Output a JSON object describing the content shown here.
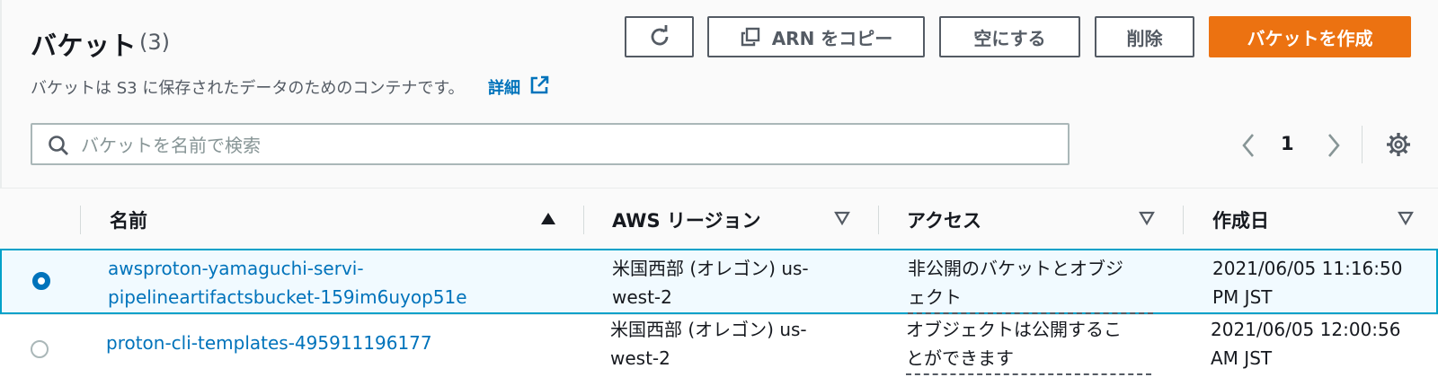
{
  "header": {
    "title": "バケット",
    "count": "(3)",
    "description": "バケットは S3 に保存されたデータのためのコンテナです。",
    "learn_more": "詳細"
  },
  "toolbar": {
    "copy_arn": "ARN をコピー",
    "empty": "空にする",
    "delete": "削除",
    "create": "バケットを作成"
  },
  "search": {
    "placeholder": "バケットを名前で検索",
    "value": ""
  },
  "pagination": {
    "current_page": "1"
  },
  "table": {
    "columns": [
      "名前",
      "AWS リージョン",
      "アクセス",
      "作成日"
    ],
    "sorted_column": "名前",
    "sort_direction": "ascending",
    "rows": [
      {
        "selected": true,
        "name_line1": "awsproton-yamaguchi-servi-",
        "name_line2": "pipelineartifactsbucket-159im6uyop51e",
        "region_line1": "米国西部 (オレゴン) us-",
        "region_line2": "west-2",
        "access_line1": "非公開のバケットとオブジ",
        "access_line2": "ェクト",
        "created_line1": "2021/06/05 11:16:50",
        "created_line2": "PM JST"
      },
      {
        "selected": false,
        "name_line1": "proton-cli-templates-495911196177",
        "name_line2": "",
        "region_line1": "米国西部 (オレゴン) us-",
        "region_line2": "west-2",
        "access_line1": "オブジェクトは公開するこ",
        "access_line2": "とができます",
        "created_line1": "2021/06/05 12:00:56",
        "created_line2": "AM JST"
      }
    ]
  },
  "colors": {
    "primary": "#ec7211",
    "link": "#0073bb",
    "selected_border": "#00a1c9",
    "selected_bg": "#f1faff"
  },
  "icons": [
    "refresh-icon",
    "copy-icon",
    "external-link-icon",
    "search-icon",
    "chevron-left-icon",
    "chevron-right-icon",
    "gear-icon",
    "sort-ascending-icon",
    "sort-descending-icon"
  ]
}
